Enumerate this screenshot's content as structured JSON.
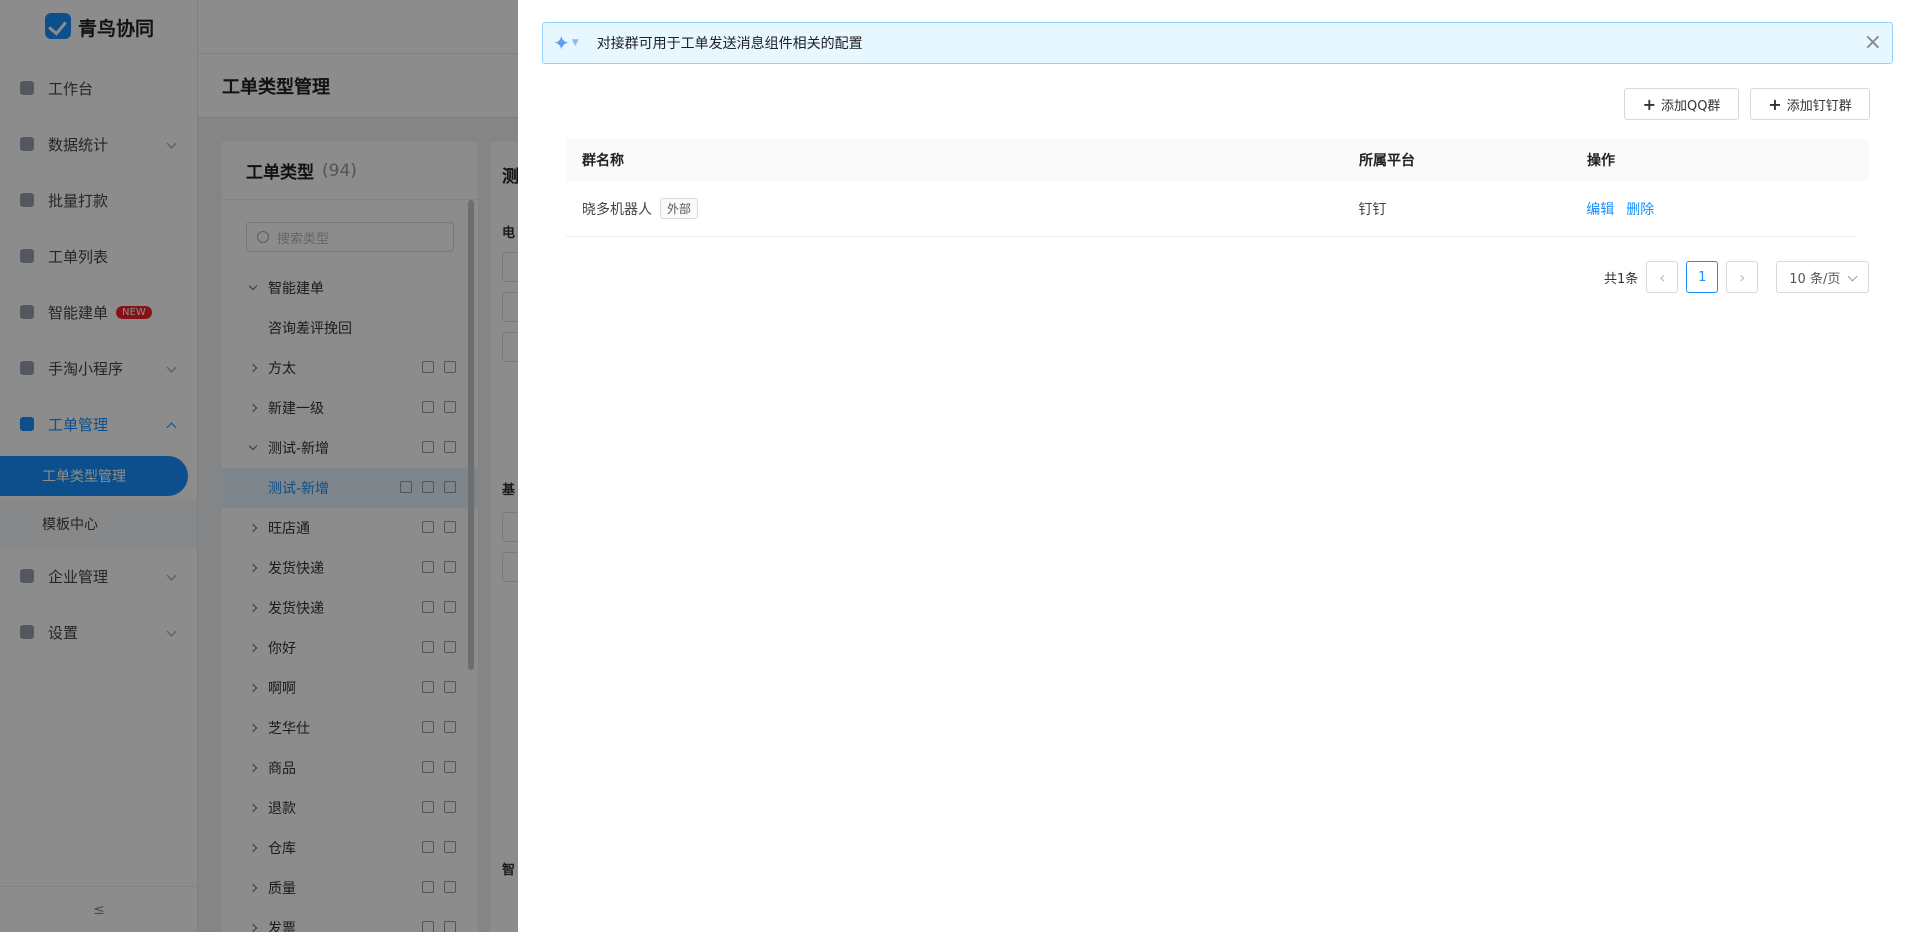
{
  "app": {
    "name": "青鸟协同"
  },
  "sidebar": {
    "items": [
      {
        "label": "工作台"
      },
      {
        "label": "数据统计"
      },
      {
        "label": "批量打款"
      },
      {
        "label": "工单列表"
      },
      {
        "label": "智能建单",
        "badge": "NEW"
      },
      {
        "label": "手淘小程序"
      },
      {
        "label": "工单管理"
      },
      {
        "label": "企业管理"
      },
      {
        "label": "设置"
      }
    ],
    "sub_items": [
      {
        "label": "工单类型管理"
      },
      {
        "label": "模板中心"
      }
    ],
    "collapse_icon": "≤"
  },
  "page": {
    "title": "工单类型管理"
  },
  "type_panel": {
    "title": "工单类型",
    "count": "(94)",
    "search_placeholder": "搜索类型",
    "tree": [
      {
        "label": "智能建单"
      },
      {
        "label": "咨询差评挽回"
      },
      {
        "label": "方太"
      },
      {
        "label": "新建一级"
      },
      {
        "label": "测试-新增"
      },
      {
        "label": "测试-新增"
      },
      {
        "label": "旺店通"
      },
      {
        "label": "发货快递"
      },
      {
        "label": "发货快递"
      },
      {
        "label": "你好"
      },
      {
        "label": "啊啊"
      },
      {
        "label": "芝华仕"
      },
      {
        "label": "商品"
      },
      {
        "label": "退款"
      },
      {
        "label": "仓库"
      },
      {
        "label": "质量"
      },
      {
        "label": "发票"
      }
    ]
  },
  "right_panel": {
    "title_fragment": "测",
    "labels": [
      "电",
      "基",
      "智"
    ]
  },
  "drawer": {
    "alert_text": "对接群可用于工单发送消息组件相关的配置",
    "add_qq_label": "添加QQ群",
    "add_dingtalk_label": "添加钉钉群",
    "columns": [
      "群名称",
      "所属平台",
      "操作"
    ],
    "rows": [
      {
        "name": "晓多机器人",
        "tag": "外部",
        "platform": "钉钉",
        "edit": "编辑",
        "delete": "删除"
      }
    ],
    "pagination": {
      "total": "共1条",
      "current": "1",
      "page_size": "10 条/页"
    }
  }
}
